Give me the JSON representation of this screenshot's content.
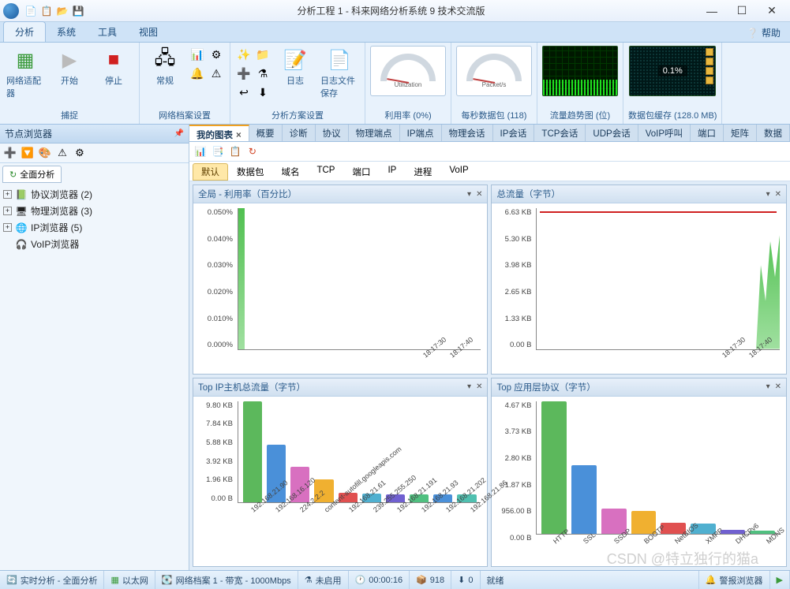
{
  "title": "分析工程 1 - 科来网络分析系统 9 技术交流版",
  "menu": {
    "tabs": [
      "分析",
      "系统",
      "工具",
      "视图"
    ],
    "help": "帮助"
  },
  "ribbon": {
    "capture": {
      "adapter": "网络适配器",
      "start": "开始",
      "stop": "停止",
      "label": "捕捉"
    },
    "profile": {
      "normal": "常规",
      "label": "网络档案设置"
    },
    "scheme": {
      "log": "日志",
      "logsave": "日志文件保存",
      "label": "分析方案设置"
    },
    "util": {
      "label": "利用率 (0%)",
      "gauge": "Utilization"
    },
    "pkts": {
      "label": "每秒数据包 (118)",
      "gauge": "Packet/s"
    },
    "trend": {
      "label": "流量趋势图 (位)"
    },
    "buffer": {
      "label": "数据包缓存 (128.0 MB)",
      "pct": "0.1%"
    }
  },
  "sidebar": {
    "title": "节点浏览器",
    "tab": "全面分析",
    "nodes": [
      {
        "label": "协议浏览器 (2)",
        "icon": "📗"
      },
      {
        "label": "物理浏览器 (3)",
        "icon": "🖥"
      },
      {
        "label": "IP浏览器 (5)",
        "icon": "🌐"
      },
      {
        "label": "VoIP浏览器",
        "icon": "🎧"
      }
    ]
  },
  "maintabs": [
    "我的图表",
    "概要",
    "诊断",
    "协议",
    "物理端点",
    "IP端点",
    "物理会话",
    "IP会话",
    "TCP会话",
    "UDP会话",
    "VoIP呼叫",
    "端口",
    "矩阵",
    "数据"
  ],
  "subtabs": [
    "默认",
    "数据包",
    "域名",
    "TCP",
    "端口",
    "IP",
    "进程",
    "VoIP"
  ],
  "charts": {
    "c1": {
      "title": "全局 - 利用率（百分比）"
    },
    "c2": {
      "title": "总流量（字节）"
    },
    "c3": {
      "title": "Top IP主机总流量（字节）"
    },
    "c4": {
      "title": "Top 应用层协议（字节）"
    }
  },
  "chart_data": [
    {
      "id": "c1",
      "type": "line",
      "title": "全局 - 利用率（百分比）",
      "ylabel": "%",
      "ylim": [
        0,
        0.055
      ],
      "yticks": [
        "0.050%",
        "0.040%",
        "0.030%",
        "0.020%",
        "0.010%",
        "0.000%"
      ],
      "x": [
        "18:17:30",
        "18:17:40"
      ],
      "values": [
        0,
        0,
        0
      ]
    },
    {
      "id": "c2",
      "type": "area",
      "title": "总流量（字节）",
      "ylim": [
        0,
        7000
      ],
      "yticks": [
        "6.63 KB",
        "5.30 KB",
        "3.98 KB",
        "2.65 KB",
        "1.33 KB",
        "0.00 B"
      ],
      "x": [
        "18:17:30",
        "18:17:40"
      ],
      "values": [
        6630,
        6630,
        6500
      ]
    },
    {
      "id": "c3",
      "type": "bar",
      "title": "Top IP主机总流量（字节）",
      "yticks": [
        "9.80 KB",
        "7.84 KB",
        "5.88 KB",
        "3.92 KB",
        "1.96 KB",
        "0.00 B"
      ],
      "categories": [
        "192.168.21.90",
        "192.168.16.120",
        "224.2.2.2",
        "content-autofill.googleapis.com",
        "192.168.21.61",
        "239.255.255.250",
        "192.168.21.191",
        "192.168.21.93",
        "192.168.21.202",
        "192.168.21.86"
      ],
      "values": [
        9800,
        5600,
        3400,
        2200,
        900,
        850,
        800,
        780,
        760,
        750
      ],
      "colors": [
        "#5cb85c",
        "#4a90d9",
        "#d870c0",
        "#f0b030",
        "#e05050",
        "#50b0d0",
        "#7060d0",
        "#50c080",
        "#4a90d9",
        "#50c0b0"
      ]
    },
    {
      "id": "c4",
      "type": "bar",
      "title": "Top 应用层协议（字节）",
      "yticks": [
        "4.67 KB",
        "3.73 KB",
        "2.80 KB",
        "1.87 KB",
        "956.00 B",
        "0.00 B"
      ],
      "categories": [
        "HTTP",
        "SSL",
        "SSDP",
        "BOOTP",
        "NetBIOS",
        "XMPP",
        "DHCPv6",
        "MDNS"
      ],
      "values": [
        4670,
        2400,
        900,
        800,
        400,
        350,
        150,
        120
      ],
      "colors": [
        "#5cb85c",
        "#4a90d9",
        "#d870c0",
        "#f0b030",
        "#e05050",
        "#50b0d0",
        "#7060d0",
        "#50c080"
      ]
    }
  ],
  "status": {
    "s1": "实时分析 - 全面分析",
    "s2": "以太网",
    "s3": "网络档案 1 - 带宽 - 1000Mbps",
    "s4": "未启用",
    "s5": "00:00:16",
    "s6": "918",
    "s7": "0",
    "s8": "就绪",
    "s9": "警报浏览器"
  },
  "watermark": "CSDN @特立独行的猫a"
}
